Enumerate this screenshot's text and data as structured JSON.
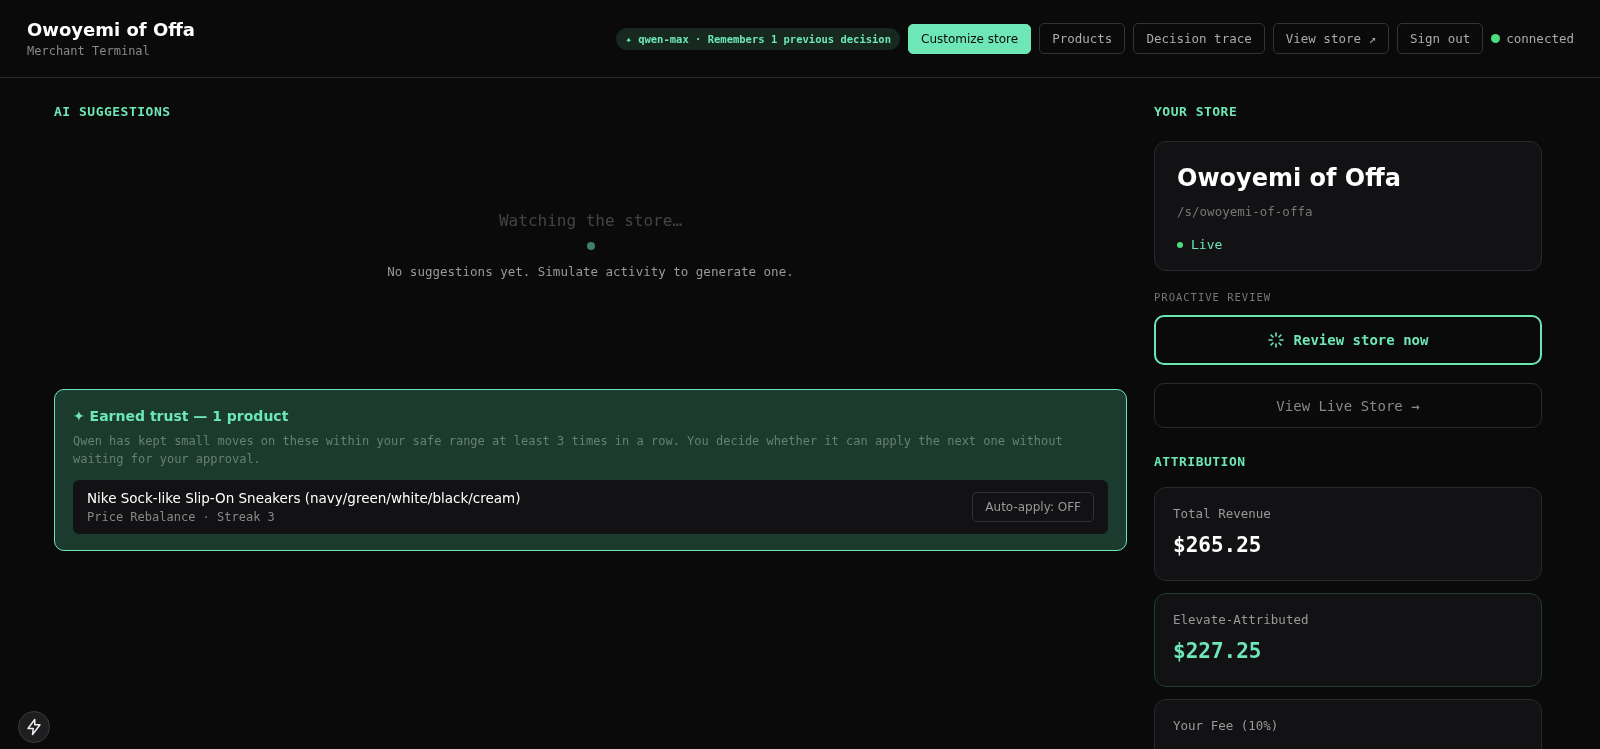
{
  "header": {
    "title": "Owoyemi of Offa",
    "subtitle": "Merchant Terminal",
    "model_badge": {
      "icon": "✦",
      "text": "qwen-max · Remembers 1 previous decision"
    },
    "nav": [
      {
        "label": "Customize store",
        "kind": "primary"
      },
      {
        "label": "Products",
        "kind": "outline"
      },
      {
        "label": "Decision trace",
        "kind": "outline"
      },
      {
        "label": "View store ↗",
        "kind": "outline"
      },
      {
        "label": "Sign out",
        "kind": "outline"
      }
    ],
    "connection": {
      "label": "connected",
      "connected": true
    }
  },
  "suggestions": {
    "heading": "AI SUGGESTIONS",
    "empty_title": "Watching the store…",
    "empty_text": "No suggestions yet. Simulate activity to generate one."
  },
  "earned_trust": {
    "icon": "✦",
    "title": "Earned trust — 1 product",
    "description": "Qwen has kept small moves on these within your safe range at least 3 times in a row. You decide whether it can apply the next one without waiting for your approval.",
    "products": [
      {
        "name": "Nike Sock-like Slip-On Sneakers (navy/green/white/black/cream)",
        "meta": "Price Rebalance · Streak 3",
        "auto_apply": {
          "label": "Auto-apply: OFF",
          "on": false
        }
      }
    ]
  },
  "store": {
    "heading": "YOUR STORE",
    "name": "Owoyemi of Offa",
    "path": "/s/owoyemi-of-offa",
    "status": "Live",
    "live": true
  },
  "review": {
    "heading": "PROACTIVE REVIEW",
    "button": "Review store now",
    "view_live": "View Live Store →"
  },
  "attribution": {
    "heading": "ATTRIBUTION",
    "metrics": [
      {
        "label": "Total Revenue",
        "value": "$265.25",
        "highlight": false
      },
      {
        "label": "Elevate-Attributed",
        "value": "$227.25",
        "highlight": true
      },
      {
        "label": "Your Fee (10%)",
        "highlight": false
      }
    ]
  }
}
